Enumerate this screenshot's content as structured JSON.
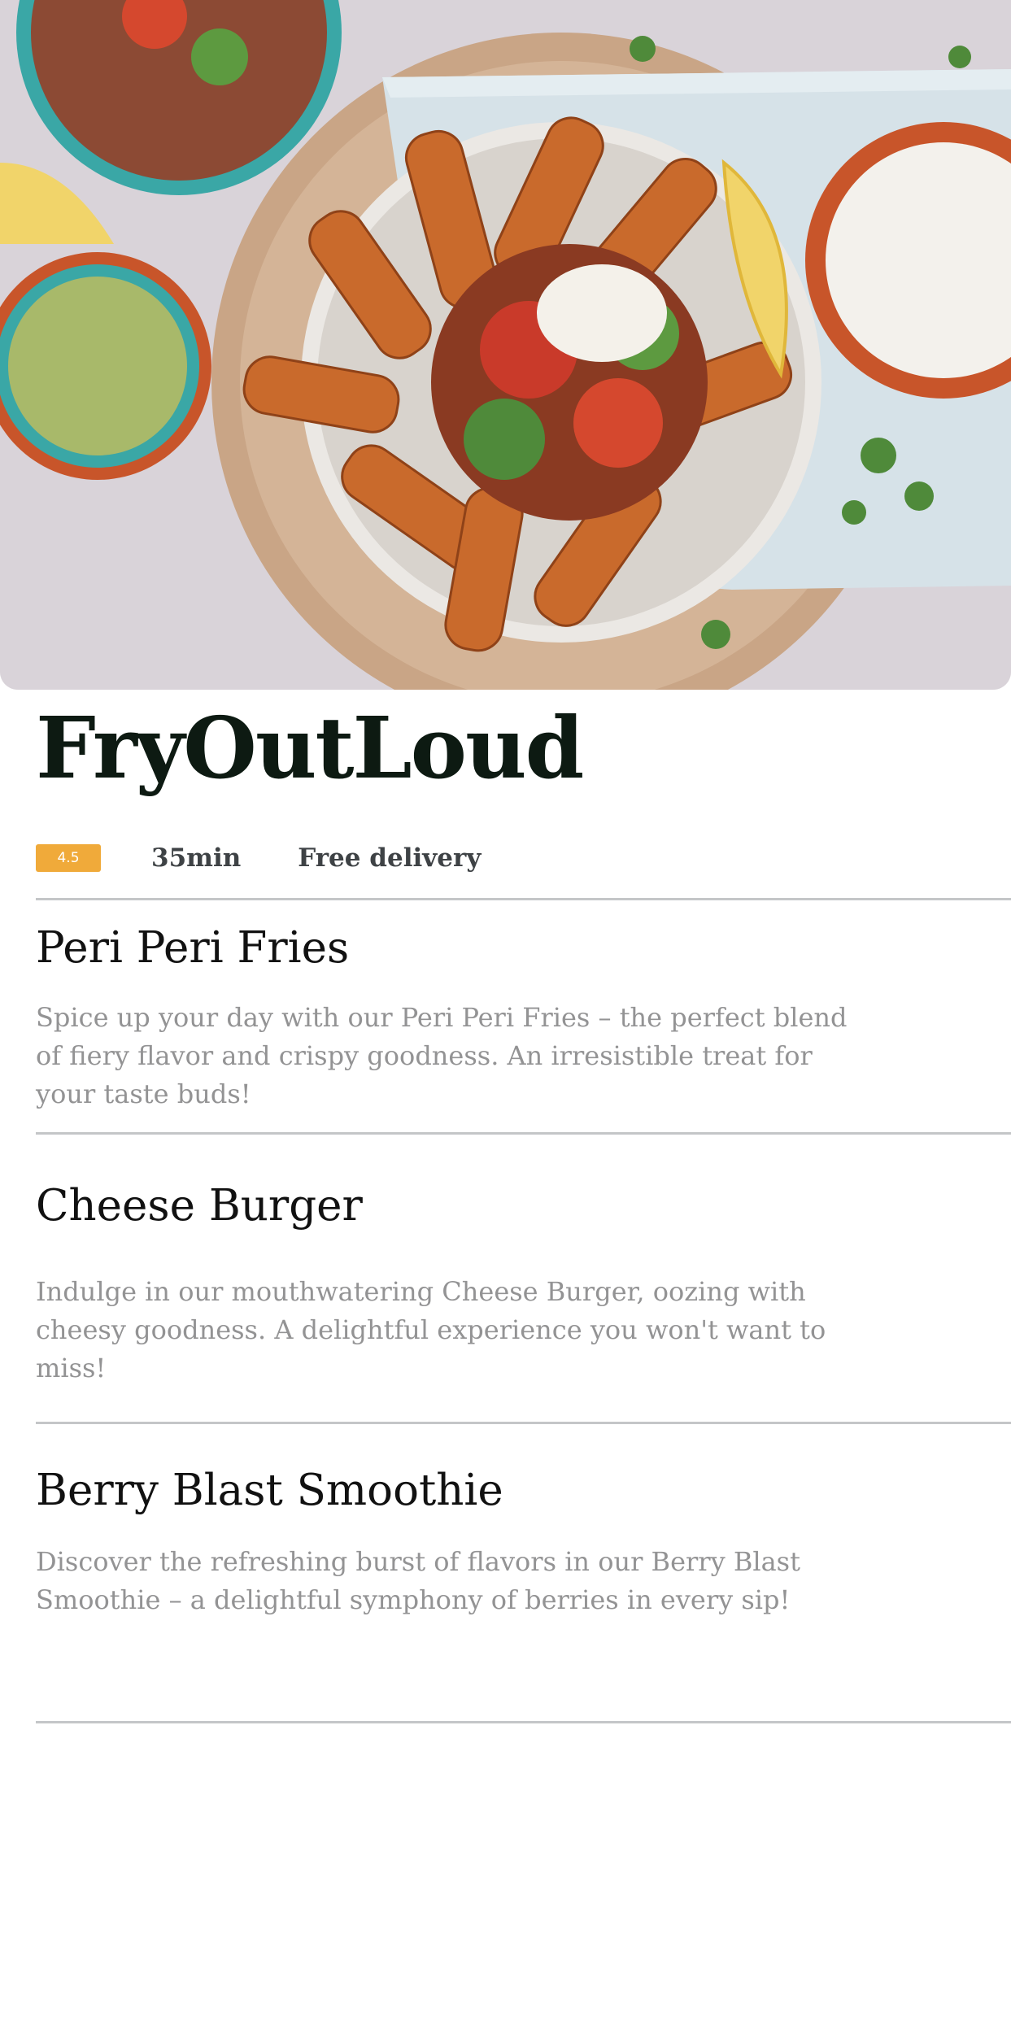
{
  "restaurant": {
    "name": "FryOutLoud",
    "rating": "4.5",
    "time": "35min",
    "delivery": "Free delivery",
    "rating_color": "#f0aa3a",
    "hero_image": "food-platter-image"
  },
  "menu": {
    "items": [
      {
        "name": "Peri Peri Fries",
        "description": "Spice up your day with our Peri Peri Fries – the perfect blend of fiery flavor and crispy goodness. An irresistible treat for your taste buds!"
      },
      {
        "name": "Cheese Burger",
        "description": "Indulge in our mouthwatering Cheese Burger, oozing with cheesy goodness. A delightful experience you won't want to miss!"
      },
      {
        "name": "Berry Blast Smoothie",
        "description": "Discover the refreshing burst of flavors in our Berry Blast Smoothie – a delightful symphony of berries in every sip!"
      }
    ]
  }
}
